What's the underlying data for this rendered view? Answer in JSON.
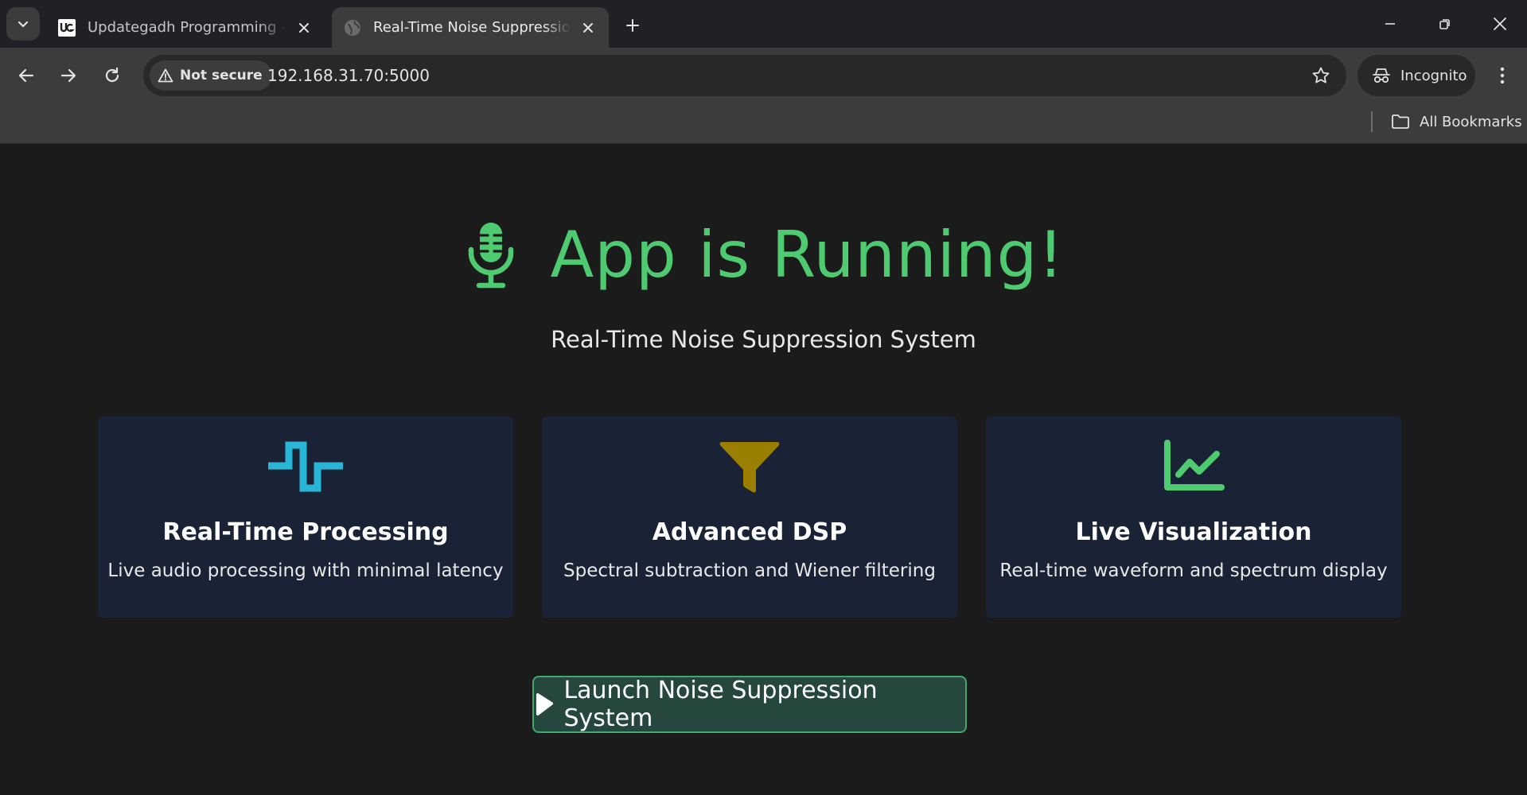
{
  "browser": {
    "tabs": [
      {
        "title": "Updategadh Programming - Up",
        "active": false,
        "favicon": "updategadh-logo-icon"
      },
      {
        "title": "Real-Time Noise Suppression Sy",
        "active": true,
        "favicon": "globe-icon"
      }
    ],
    "security_label": "Not secure",
    "url": "192.168.31.70:5000",
    "incognito_label": "Incognito",
    "bookmarks_label": "All Bookmarks"
  },
  "page": {
    "title": "App is Running!",
    "subtitle": "Real-Time Noise Suppression System",
    "features": [
      {
        "icon": "waveform-icon",
        "title": "Real-Time Processing",
        "description": "Live audio processing with minimal latency",
        "color": "#29b6d6"
      },
      {
        "icon": "filter-icon",
        "title": "Advanced DSP",
        "description": "Spectral subtraction and Wiener filtering",
        "color": "#9a7f00"
      },
      {
        "icon": "chart-line-icon",
        "title": "Live Visualization",
        "description": "Real-time waveform and spectrum display",
        "color": "#4ecb71"
      }
    ],
    "launch_label": "Launch Noise Suppression System"
  },
  "colors": {
    "accent": "#4ecb71",
    "card_bg": "#1a2236",
    "page_bg": "#1b1b1b",
    "button_bg": "#26473d"
  }
}
